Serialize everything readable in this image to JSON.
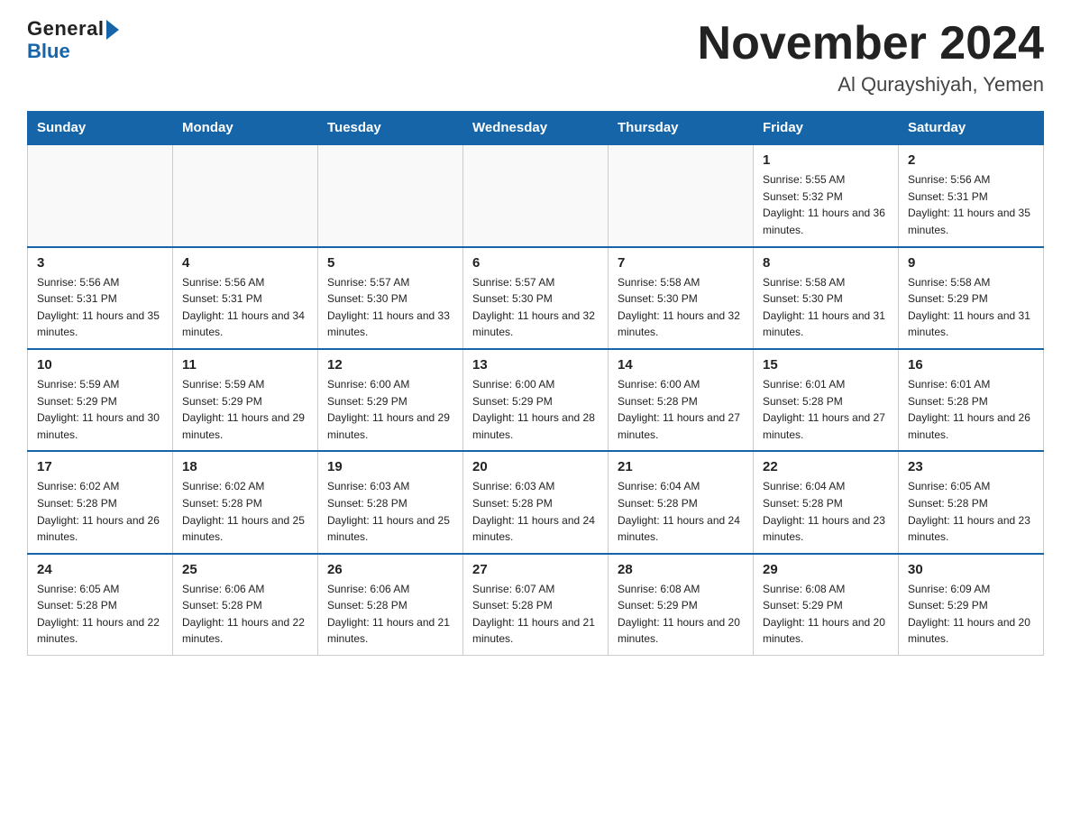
{
  "header": {
    "logo_general": "General",
    "logo_blue": "Blue",
    "month_title": "November 2024",
    "location": "Al Qurayshiyah, Yemen"
  },
  "weekdays": [
    "Sunday",
    "Monday",
    "Tuesday",
    "Wednesday",
    "Thursday",
    "Friday",
    "Saturday"
  ],
  "weeks": [
    [
      {
        "day": "",
        "info": ""
      },
      {
        "day": "",
        "info": ""
      },
      {
        "day": "",
        "info": ""
      },
      {
        "day": "",
        "info": ""
      },
      {
        "day": "",
        "info": ""
      },
      {
        "day": "1",
        "info": "Sunrise: 5:55 AM\nSunset: 5:32 PM\nDaylight: 11 hours and 36 minutes."
      },
      {
        "day": "2",
        "info": "Sunrise: 5:56 AM\nSunset: 5:31 PM\nDaylight: 11 hours and 35 minutes."
      }
    ],
    [
      {
        "day": "3",
        "info": "Sunrise: 5:56 AM\nSunset: 5:31 PM\nDaylight: 11 hours and 35 minutes."
      },
      {
        "day": "4",
        "info": "Sunrise: 5:56 AM\nSunset: 5:31 PM\nDaylight: 11 hours and 34 minutes."
      },
      {
        "day": "5",
        "info": "Sunrise: 5:57 AM\nSunset: 5:30 PM\nDaylight: 11 hours and 33 minutes."
      },
      {
        "day": "6",
        "info": "Sunrise: 5:57 AM\nSunset: 5:30 PM\nDaylight: 11 hours and 32 minutes."
      },
      {
        "day": "7",
        "info": "Sunrise: 5:58 AM\nSunset: 5:30 PM\nDaylight: 11 hours and 32 minutes."
      },
      {
        "day": "8",
        "info": "Sunrise: 5:58 AM\nSunset: 5:30 PM\nDaylight: 11 hours and 31 minutes."
      },
      {
        "day": "9",
        "info": "Sunrise: 5:58 AM\nSunset: 5:29 PM\nDaylight: 11 hours and 31 minutes."
      }
    ],
    [
      {
        "day": "10",
        "info": "Sunrise: 5:59 AM\nSunset: 5:29 PM\nDaylight: 11 hours and 30 minutes."
      },
      {
        "day": "11",
        "info": "Sunrise: 5:59 AM\nSunset: 5:29 PM\nDaylight: 11 hours and 29 minutes."
      },
      {
        "day": "12",
        "info": "Sunrise: 6:00 AM\nSunset: 5:29 PM\nDaylight: 11 hours and 29 minutes."
      },
      {
        "day": "13",
        "info": "Sunrise: 6:00 AM\nSunset: 5:29 PM\nDaylight: 11 hours and 28 minutes."
      },
      {
        "day": "14",
        "info": "Sunrise: 6:00 AM\nSunset: 5:28 PM\nDaylight: 11 hours and 27 minutes."
      },
      {
        "day": "15",
        "info": "Sunrise: 6:01 AM\nSunset: 5:28 PM\nDaylight: 11 hours and 27 minutes."
      },
      {
        "day": "16",
        "info": "Sunrise: 6:01 AM\nSunset: 5:28 PM\nDaylight: 11 hours and 26 minutes."
      }
    ],
    [
      {
        "day": "17",
        "info": "Sunrise: 6:02 AM\nSunset: 5:28 PM\nDaylight: 11 hours and 26 minutes."
      },
      {
        "day": "18",
        "info": "Sunrise: 6:02 AM\nSunset: 5:28 PM\nDaylight: 11 hours and 25 minutes."
      },
      {
        "day": "19",
        "info": "Sunrise: 6:03 AM\nSunset: 5:28 PM\nDaylight: 11 hours and 25 minutes."
      },
      {
        "day": "20",
        "info": "Sunrise: 6:03 AM\nSunset: 5:28 PM\nDaylight: 11 hours and 24 minutes."
      },
      {
        "day": "21",
        "info": "Sunrise: 6:04 AM\nSunset: 5:28 PM\nDaylight: 11 hours and 24 minutes."
      },
      {
        "day": "22",
        "info": "Sunrise: 6:04 AM\nSunset: 5:28 PM\nDaylight: 11 hours and 23 minutes."
      },
      {
        "day": "23",
        "info": "Sunrise: 6:05 AM\nSunset: 5:28 PM\nDaylight: 11 hours and 23 minutes."
      }
    ],
    [
      {
        "day": "24",
        "info": "Sunrise: 6:05 AM\nSunset: 5:28 PM\nDaylight: 11 hours and 22 minutes."
      },
      {
        "day": "25",
        "info": "Sunrise: 6:06 AM\nSunset: 5:28 PM\nDaylight: 11 hours and 22 minutes."
      },
      {
        "day": "26",
        "info": "Sunrise: 6:06 AM\nSunset: 5:28 PM\nDaylight: 11 hours and 21 minutes."
      },
      {
        "day": "27",
        "info": "Sunrise: 6:07 AM\nSunset: 5:28 PM\nDaylight: 11 hours and 21 minutes."
      },
      {
        "day": "28",
        "info": "Sunrise: 6:08 AM\nSunset: 5:29 PM\nDaylight: 11 hours and 20 minutes."
      },
      {
        "day": "29",
        "info": "Sunrise: 6:08 AM\nSunset: 5:29 PM\nDaylight: 11 hours and 20 minutes."
      },
      {
        "day": "30",
        "info": "Sunrise: 6:09 AM\nSunset: 5:29 PM\nDaylight: 11 hours and 20 minutes."
      }
    ]
  ]
}
